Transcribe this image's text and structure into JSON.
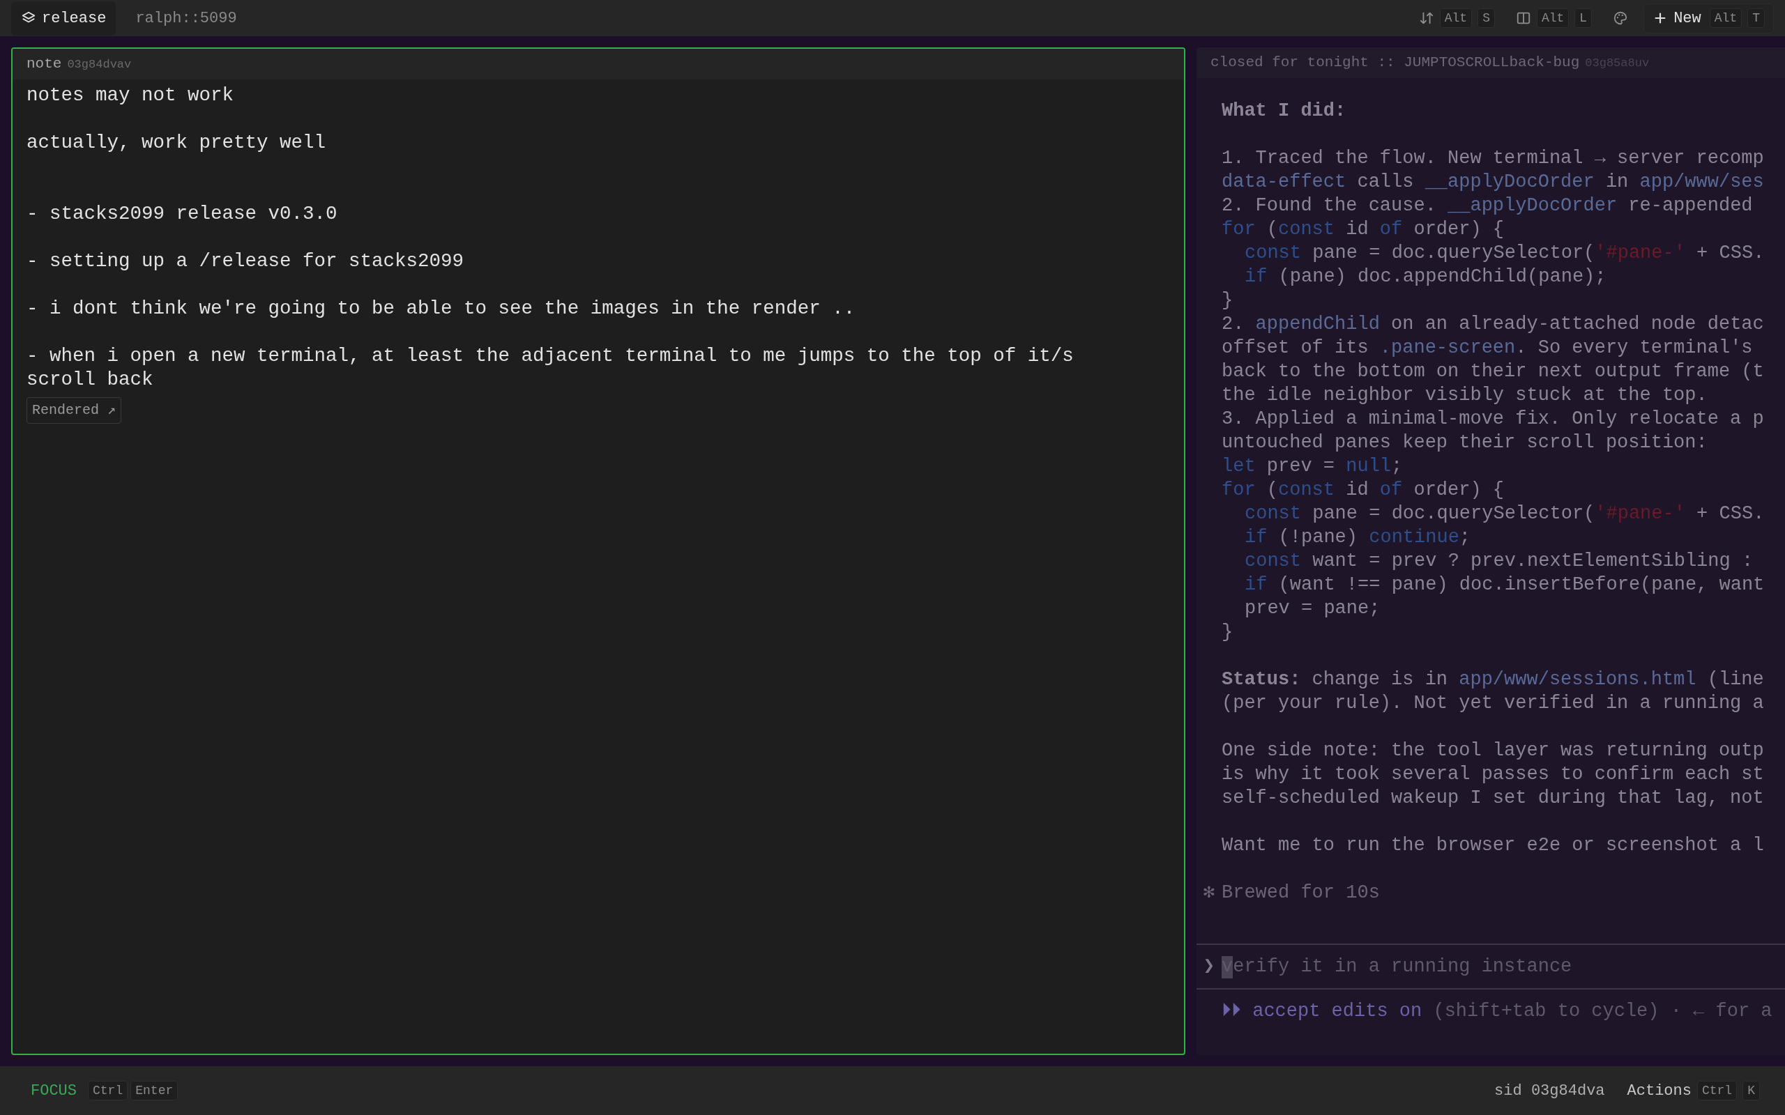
{
  "topbar": {
    "tabs": [
      {
        "label": "release",
        "selected": true
      },
      {
        "label": "ralph::5099",
        "selected": false
      }
    ],
    "actions": [
      {
        "kind": "sort",
        "keys": [
          "Alt",
          "S"
        ]
      },
      {
        "kind": "split",
        "keys": [
          "Alt",
          "L"
        ]
      },
      {
        "kind": "theme"
      },
      {
        "kind": "new",
        "label": "New",
        "keys": [
          "Alt",
          "T"
        ]
      }
    ]
  },
  "note_pane": {
    "focused": true,
    "title": "note",
    "id": "03g84dvav",
    "blocks": [
      {
        "text": "notes may not work"
      },
      {
        "text": "actually, work pretty well"
      },
      {
        "text": "- stacks2099 release v0.3.0",
        "extra_space_before": true
      },
      {
        "text": "- setting up a /release for stacks2099"
      },
      {
        "text": "- i dont think we're going to be able to see the images in the render .."
      },
      {
        "text": "- when i open a new terminal, at least the adjacent terminal to me jumps to the top of it/s scroll back"
      }
    ],
    "rendered_link": "Rendered ↗"
  },
  "terminal_pane": {
    "focused": false,
    "title": "closed for tonight :: JUMPTOSCROLLback-bug",
    "id": "03g85a8uv",
    "blocks": [
      {
        "lines": [
          {
            "segments": [
              {
                "kind": "bold",
                "text": "What I did:"
              }
            ]
          }
        ]
      },
      {
        "lines": [
          {
            "text": "1. Traced the flow. New terminal → server recomp"
          },
          {
            "segments": [
              {
                "kind": "path",
                "text": "data-effect"
              },
              {
                "kind": "plain",
                "text": " calls "
              },
              {
                "kind": "path",
                "text": "__applyDocOrder"
              },
              {
                "kind": "plain",
                "text": " in "
              },
              {
                "kind": "path",
                "text": "app/www/ses"
              }
            ]
          },
          {
            "segments": [
              {
                "kind": "plain",
                "text": "2. Found the cause. "
              },
              {
                "kind": "path",
                "text": "__applyDocOrder"
              },
              {
                "kind": "plain",
                "text": " re-appended"
              }
            ]
          },
          {
            "segments": [
              {
                "kind": "keyword",
                "text": "for"
              },
              {
                "kind": "plain",
                "text": " ("
              },
              {
                "kind": "keyword",
                "text": "const"
              },
              {
                "kind": "plain",
                "text": " id "
              },
              {
                "kind": "keyword",
                "text": "of"
              },
              {
                "kind": "plain",
                "text": " order) {"
              }
            ]
          },
          {
            "indented": true,
            "segments": [
              {
                "kind": "keyword",
                "text": "const"
              },
              {
                "kind": "plain",
                "text": " pane = doc.querySelector("
              },
              {
                "kind": "string",
                "text": "'#pane-'"
              },
              {
                "kind": "plain",
                "text": " + CSS."
              }
            ]
          },
          {
            "indented": true,
            "segments": [
              {
                "kind": "keyword",
                "text": "if"
              },
              {
                "kind": "plain",
                "text": " (pane) doc.appendChild(pane);"
              }
            ]
          },
          {
            "text": "}"
          },
          {
            "segments": [
              {
                "kind": "plain",
                "text": "2. "
              },
              {
                "kind": "path",
                "text": "appendChild"
              },
              {
                "kind": "plain",
                "text": " on an already-attached node detac"
              }
            ]
          },
          {
            "segments": [
              {
                "kind": "plain",
                "text": "offset of its "
              },
              {
                "kind": "path",
                "text": ".pane-screen"
              },
              {
                "kind": "plain",
                "text": ". So every terminal's"
              }
            ]
          },
          {
            "text": "back to the bottom on their next output frame (t"
          },
          {
            "text": "the idle neighbor visibly stuck at the top."
          },
          {
            "text": "3. Applied a minimal-move fix. Only relocate a p"
          },
          {
            "text": "untouched panes keep their scroll position:"
          },
          {
            "segments": [
              {
                "kind": "keyword",
                "text": "let"
              },
              {
                "kind": "plain",
                "text": " prev = "
              },
              {
                "kind": "keyword",
                "text": "null"
              },
              {
                "kind": "plain",
                "text": ";"
              }
            ]
          },
          {
            "segments": [
              {
                "kind": "keyword",
                "text": "for"
              },
              {
                "kind": "plain",
                "text": " ("
              },
              {
                "kind": "keyword",
                "text": "const"
              },
              {
                "kind": "plain",
                "text": " id "
              },
              {
                "kind": "keyword",
                "text": "of"
              },
              {
                "kind": "plain",
                "text": " order) {"
              }
            ]
          },
          {
            "indented": true,
            "segments": [
              {
                "kind": "keyword",
                "text": "const"
              },
              {
                "kind": "plain",
                "text": " pane = doc.querySelector("
              },
              {
                "kind": "string",
                "text": "'#pane-'"
              },
              {
                "kind": "plain",
                "text": " + CSS."
              }
            ]
          },
          {
            "indented": true,
            "segments": [
              {
                "kind": "keyword",
                "text": "if"
              },
              {
                "kind": "plain",
                "text": " (!pane) "
              },
              {
                "kind": "keyword",
                "text": "continue"
              },
              {
                "kind": "plain",
                "text": ";"
              }
            ]
          },
          {
            "indented": true,
            "segments": [
              {
                "kind": "keyword",
                "text": "const"
              },
              {
                "kind": "plain",
                "text": " want = prev ? prev.nextElementSibling :"
              }
            ]
          },
          {
            "indented": true,
            "segments": [
              {
                "kind": "keyword",
                "text": "if"
              },
              {
                "kind": "plain",
                "text": " (want !== pane) doc.insertBefore(pane, want"
              }
            ]
          },
          {
            "indented": true,
            "text": "prev = pane;"
          },
          {
            "text": "}"
          }
        ]
      },
      {
        "lines": [
          {
            "segments": [
              {
                "kind": "bold",
                "text": "Status:"
              },
              {
                "kind": "plain",
                "text": " change is in "
              },
              {
                "kind": "path",
                "text": "app/www/sessions.html"
              },
              {
                "kind": "plain",
                "text": " (line"
              }
            ]
          },
          {
            "text": "(per your rule). Not yet verified in a running a"
          }
        ]
      },
      {
        "lines": [
          {
            "text": "One side note: the tool layer was returning outp"
          },
          {
            "text": "is why it took several passes to confirm each st"
          },
          {
            "text": "self-scheduled wakeup I set during that lag, not"
          }
        ]
      },
      {
        "lines": [
          {
            "text": "Want me to run the browser e2e or screenshot a l"
          }
        ]
      }
    ],
    "status": {
      "icon": "✻",
      "text": "Brewed for 10s"
    },
    "prompt": {
      "symbol": "❯",
      "value": "verify it in a running instance"
    },
    "mode_line": [
      {
        "kind": "accent",
        "text": "⏵⏵ accept edits on"
      },
      {
        "kind": "plain",
        "text": " (shift+tab to cycle) · ← for a"
      }
    ]
  },
  "bottombar": {
    "mode": {
      "label": "FOCUS",
      "keys": [
        "Ctrl",
        "Enter"
      ]
    },
    "session": "sid 03g84dva",
    "actions": {
      "label": "Actions",
      "keys": [
        "Ctrl",
        "K"
      ]
    }
  }
}
